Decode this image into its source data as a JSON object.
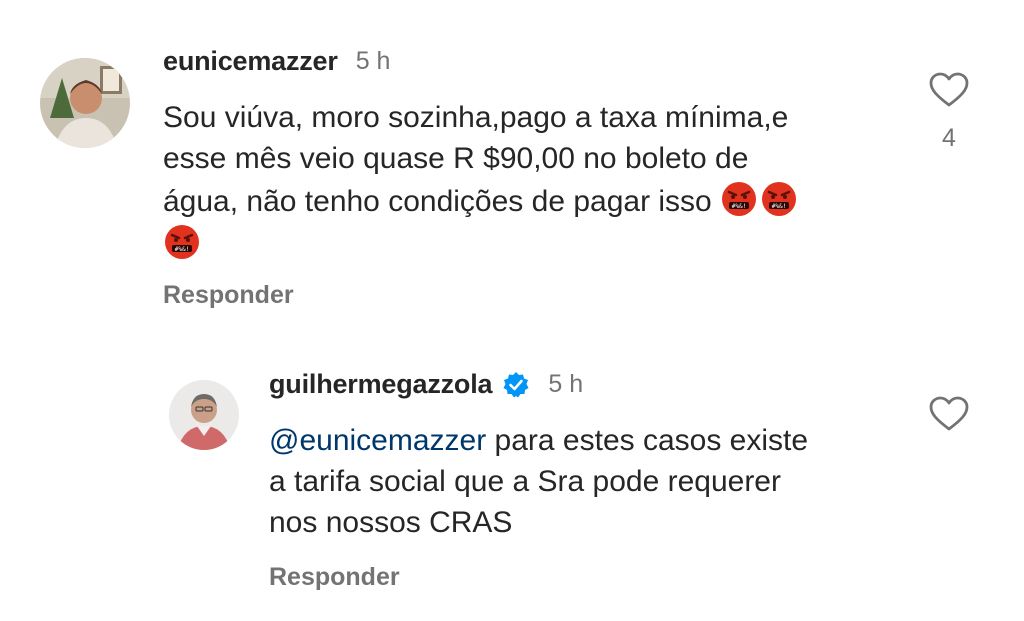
{
  "comment": {
    "username": "eunicemazzer",
    "time": "5 h",
    "lines": [
      "Sou viúva, moro sozinha,pago a taxa mínima,e",
      "esse mês veio quase R $90,00 no boleto de",
      "água, não tenho condições de pagar isso"
    ],
    "emoji": "enraged-face-with-symbols-icon",
    "emoji_count": 3,
    "like_count": "4",
    "reply_label": "Responder"
  },
  "reply": {
    "username": "guilhermegazzola",
    "verified": true,
    "time": "5 h",
    "mention": "@eunicemazzer",
    "line1_rest": " para estes casos existe",
    "lines": [
      "a tarifa social que a Sra pode requerer",
      "nos nossos CRAS"
    ],
    "like_count": "",
    "reply_label": "Responder"
  },
  "colors": {
    "text": "#262626",
    "secondary": "#737373",
    "mention": "#00376b",
    "verified": "#0095f6",
    "emoji_red": "#e0321e"
  }
}
